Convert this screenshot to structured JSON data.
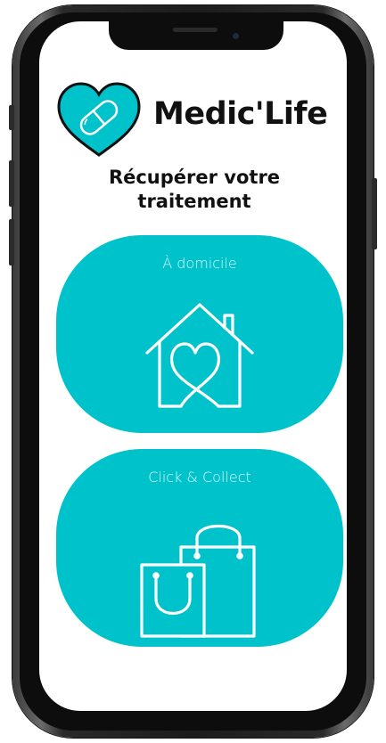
{
  "app": {
    "title": "Medic'Life",
    "subtitle": "Récupérer votre traitement"
  },
  "options": [
    {
      "label": "À domicile",
      "icon": "house-heart-icon"
    },
    {
      "label": "Click & Collect",
      "icon": "shopping-bags-icon"
    }
  ],
  "colors": {
    "accent": "#00c2cb",
    "text": "#111111",
    "card_label": "#dff9fa",
    "phone_frame": "#1c1c1c"
  }
}
